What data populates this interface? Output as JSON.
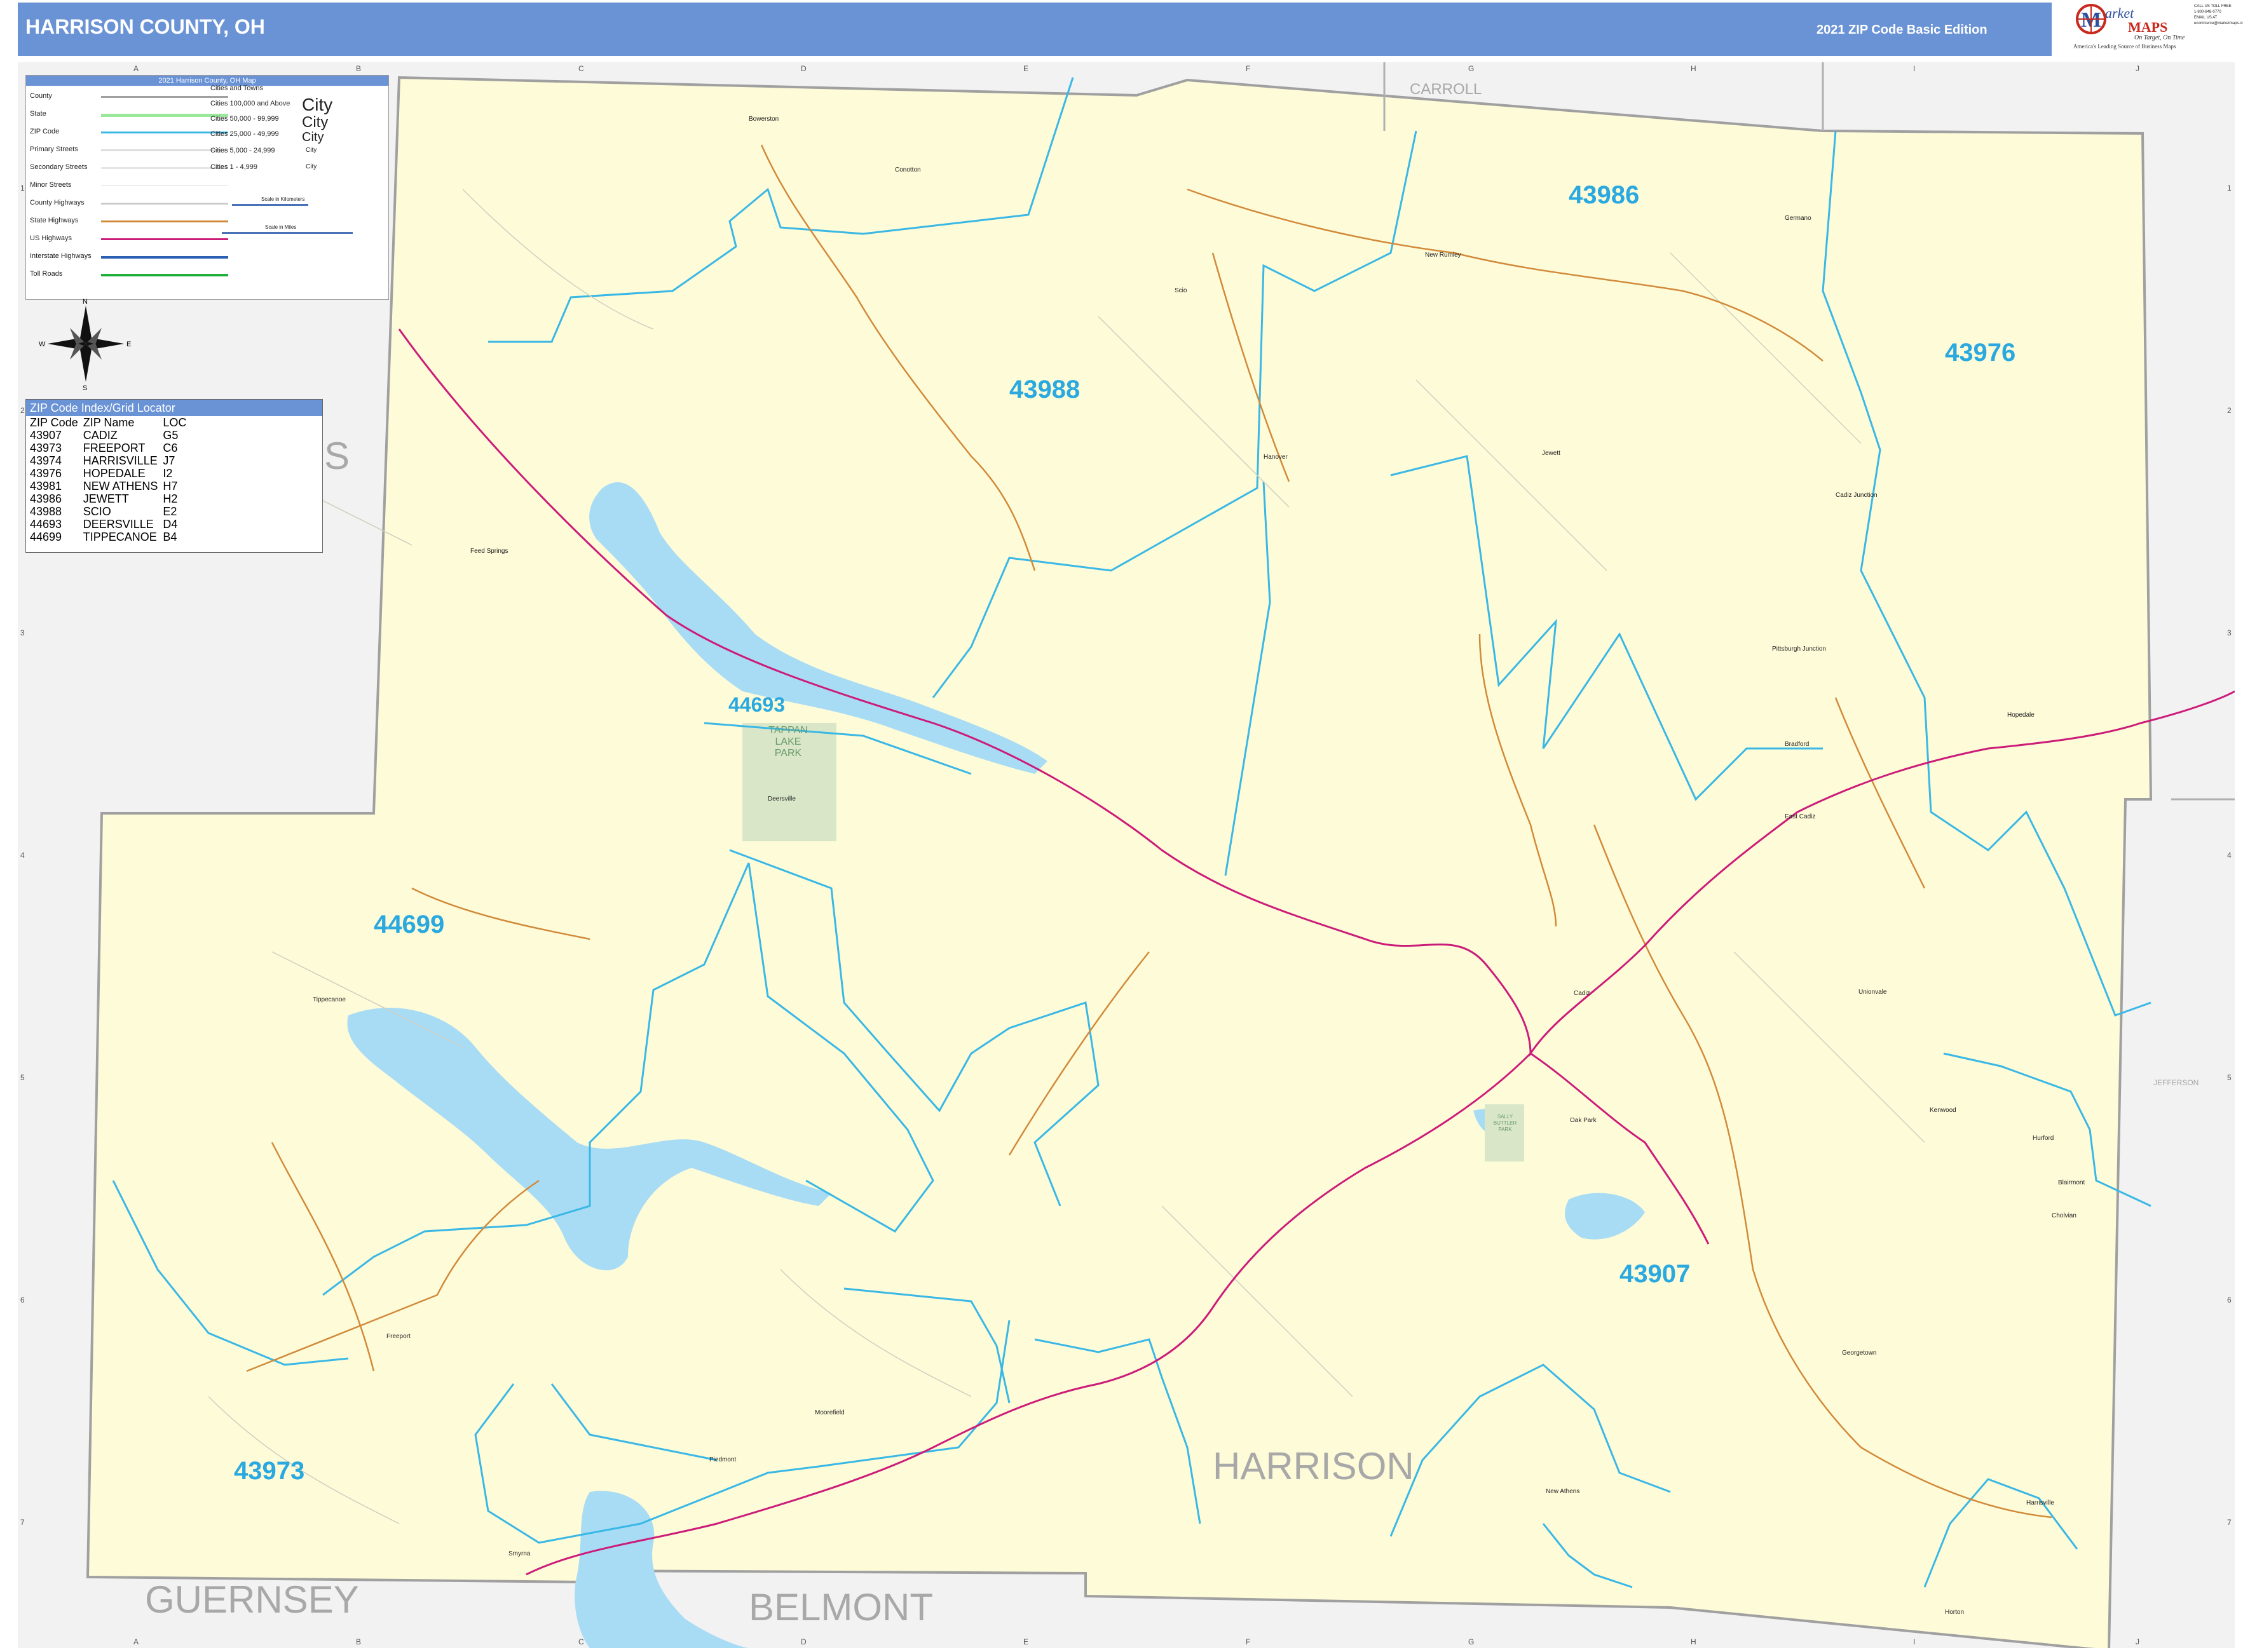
{
  "header": {
    "title": "HARRISON COUNTY, OH",
    "edition": "2021 ZIP Code Basic Edition"
  },
  "logo": {
    "brand_line1": "arket",
    "brand_line2": "MAPS",
    "slogan": "On Target, On Time",
    "tagline": "America's Leading Source of Business Maps"
  },
  "contact": [
    "CALL US TOLL FREE",
    "1-800-848-0770",
    "EMAIL US AT",
    "ecommerce@marketmaps.com"
  ],
  "legend": {
    "title": "2021 Harrison County, OH Map",
    "rows": [
      "County",
      "State",
      "ZIP Code",
      "Primary Streets",
      "Secondary Streets",
      "Minor Streets",
      "County Highways",
      "State Highways",
      "US Highways",
      "Interstate Highways",
      "Toll Roads"
    ],
    "cities_header": "Cities and Towns",
    "city_classes": [
      "Cities 100,000 and Above",
      "Cities 50,000 - 99,999",
      "Cities 25,000 - 49,999",
      "Cities 5,000 - 24,999",
      "Cities 1 - 4,999"
    ],
    "city_samples": [
      "City",
      "City",
      "City",
      "City",
      "City"
    ],
    "scale_km": "Scale in Kilometers",
    "scale_mi": "Scale in Miles"
  },
  "compass": {
    "n": "N",
    "s": "S",
    "e": "E",
    "w": "W"
  },
  "zip_index": {
    "title": "ZIP Code Index/Grid Locator",
    "columns": [
      "ZIP Code",
      "ZIP Name",
      "LOC"
    ],
    "rows": [
      [
        "43907",
        "CADIZ",
        "G5"
      ],
      [
        "43973",
        "FREEPORT",
        "C6"
      ],
      [
        "43974",
        "HARRISVILLE",
        "J7"
      ],
      [
        "43976",
        "HOPEDALE",
        "I2"
      ],
      [
        "43981",
        "NEW ATHENS",
        "H7"
      ],
      [
        "43986",
        "JEWETT",
        "H2"
      ],
      [
        "43988",
        "SCIO",
        "E2"
      ],
      [
        "44693",
        "DEERSVILLE",
        "D4"
      ],
      [
        "44699",
        "TIPPECANOE",
        "B4"
      ]
    ]
  },
  "grid": {
    "cols": [
      "A",
      "B",
      "C",
      "D",
      "E",
      "F",
      "G",
      "H",
      "I",
      "J"
    ],
    "rows": [
      "1",
      "2",
      "3",
      "4",
      "5",
      "6",
      "7"
    ]
  },
  "county_labels": {
    "carroll": "CARROLL",
    "harrison": "HARRISON",
    "guernsey": "GUERNSEY",
    "belmont": "BELMONT",
    "jefferson": "JEFFERSON",
    "tuscarawas_partial": "S"
  },
  "zip_labels": [
    "43986",
    "43976",
    "43988",
    "44693",
    "44699",
    "43907",
    "43973"
  ],
  "park_labels": {
    "tappan": [
      "TAPPAN",
      "LAKE",
      "PARK"
    ],
    "small_park": [
      "SALLY",
      "BUTTLER",
      "PARK"
    ]
  },
  "towns": [
    "Bowerston",
    "Conotton",
    "Scio",
    "New Rumley",
    "Germano",
    "Jewett",
    "Hanover",
    "Cadiz Junction",
    "Feed Springs",
    "Pittsburgh Junction",
    "Deersville",
    "Hopedale",
    "Bradford",
    "East Cadiz",
    "Cadiz",
    "Tippecanoe",
    "Unionvale",
    "Oak Park",
    "Kenwood",
    "Hurford",
    "Blairmont",
    "Cholvian",
    "Freeport",
    "Moorefield",
    "Georgetown",
    "Piedmont",
    "New Athens",
    "Harrisville",
    "Smyrna",
    "Horton"
  ],
  "colors": {
    "header": "#6a93d6",
    "county_fill": "#fefbd8",
    "neighbor_fill": "#f2f2f2",
    "water": "#a8dcf5",
    "zip_line": "#39b8e6",
    "zip_label": "#29a9e0",
    "us_highway": "#cc1c7a",
    "state_highway": "#d18a3a",
    "park": "#d9e7c8",
    "county_border": "#a0a0a0",
    "county_label": "#a8a8a8"
  }
}
